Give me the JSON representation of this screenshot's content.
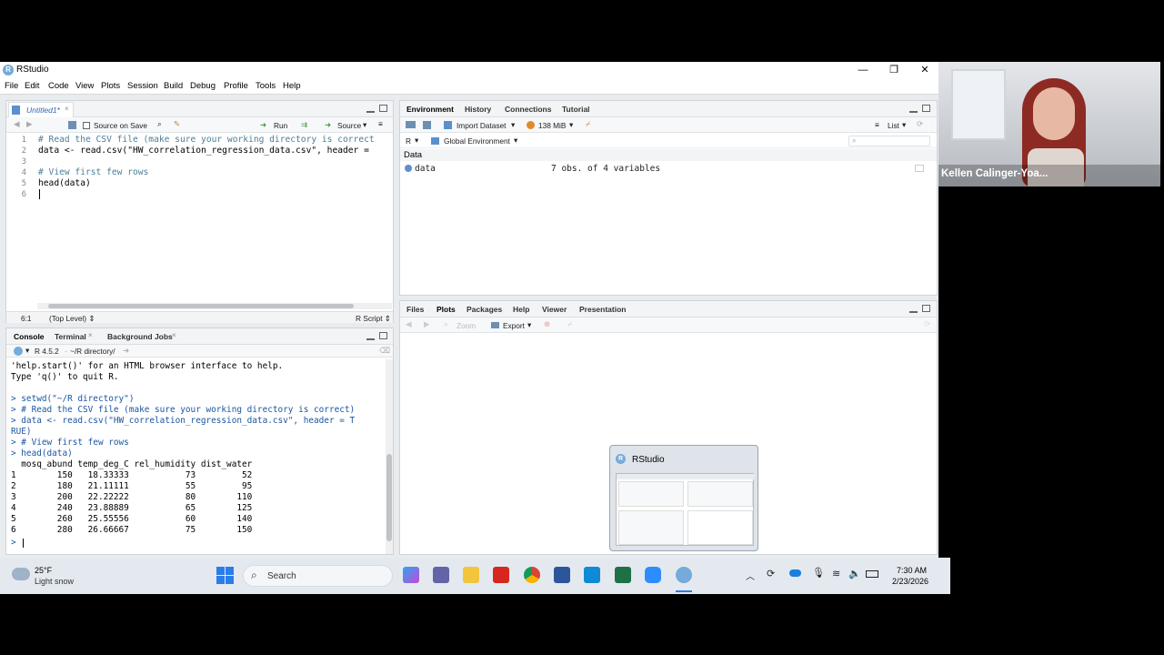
{
  "window": {
    "title": "RStudio",
    "logo": "R",
    "minimize": "—",
    "maximize": "❐",
    "close": "✕"
  },
  "menu": [
    "File",
    "Edit",
    "Code",
    "View",
    "Plots",
    "Session",
    "Build",
    "Debug",
    "Profile",
    "Tools",
    "Help"
  ],
  "editor": {
    "tab": "Untitled1*",
    "source_on_save": "Source on Save",
    "run": "Run",
    "source": "Source",
    "lines": [
      {
        "n": "1",
        "text": "# Read the CSV file (make sure your working directory is correct"
      },
      {
        "n": "2",
        "text": "data <- read.csv(\"HW_correlation_regression_data.csv\", header ="
      },
      {
        "n": "3",
        "text": ""
      },
      {
        "n": "4",
        "text": "# View first few rows"
      },
      {
        "n": "5",
        "text": "head(data)"
      },
      {
        "n": "6",
        "text": ""
      }
    ],
    "status_pos": "6:1",
    "status_scope": "(Top Level) ⇕",
    "status_type": "R Script ⇕"
  },
  "console": {
    "tabs": [
      "Console",
      "Terminal",
      "Background Jobs"
    ],
    "version": "R 4.5.2",
    "path": "~/R directory/",
    "lines": [
      "'help.start()' for an HTML browser interface to help.",
      "Type 'q()' to quit R.",
      "",
      "> setwd(\"~/R directory\")",
      "> # Read the CSV file (make sure your working directory is correct)",
      "> data <- read.csv(\"HW_correlation_regression_data.csv\", header = T",
      "RUE)",
      "> # View first few rows",
      "> head(data)",
      "  mosq_abund temp_deg_C rel_humidity dist_water",
      "1        150   18.33333           73         52",
      "2        180   21.11111           55         95",
      "3        200   22.22222           80        110",
      "4        240   23.88889           65        125",
      "5        260   25.55556           60        140",
      "6        280   26.66667           75        150",
      ">"
    ]
  },
  "environment": {
    "tabs": [
      "Environment",
      "History",
      "Connections",
      "Tutorial"
    ],
    "import_dataset": "Import Dataset",
    "memory": "138 MiB",
    "list_view": "List",
    "r_label": "R",
    "scope": "Global Environment",
    "section": "Data",
    "rows": [
      {
        "name": "data",
        "value": "7 obs. of 4 variables"
      }
    ]
  },
  "files": {
    "tabs": [
      "Files",
      "Plots",
      "Packages",
      "Help",
      "Viewer",
      "Presentation"
    ],
    "zoom": "Zoom",
    "export": "Export"
  },
  "preview": {
    "title": "RStudio"
  },
  "webcam": {
    "name": "Kellen Calinger-Yoa..."
  },
  "taskbar": {
    "weather_temp": "25°F",
    "weather_desc": "Light snow",
    "search": "Search",
    "time": "7:30 AM",
    "date": "2/23/2026"
  },
  "colors": {
    "accent": "#75aadb",
    "comment": "#4b7e9a",
    "string": "#2a8b4a",
    "prompt": "#1a55a3"
  }
}
